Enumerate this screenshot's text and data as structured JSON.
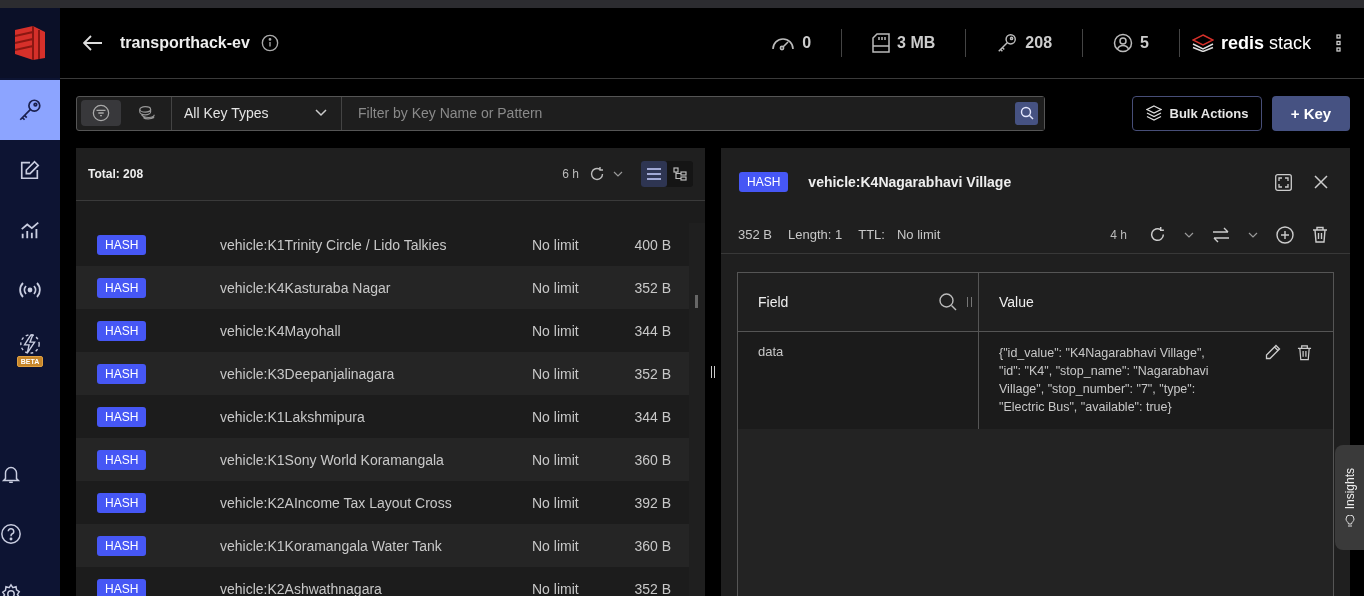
{
  "sidebar": {
    "nav": [
      {
        "kind": "browser",
        "selected": true
      },
      {
        "kind": "workbench",
        "selected": false
      },
      {
        "kind": "analysis",
        "selected": false
      },
      {
        "kind": "pubsub",
        "selected": false
      },
      {
        "kind": "triggers",
        "selected": false,
        "badge": "BETA"
      }
    ],
    "bottom": [
      {
        "kind": "notifications"
      },
      {
        "kind": "help"
      },
      {
        "kind": "settings"
      }
    ]
  },
  "header": {
    "db_name": "transporthack-ev",
    "stats": [
      {
        "kind": "ops",
        "value": "0"
      },
      {
        "kind": "memory",
        "value": "3 MB"
      },
      {
        "kind": "keys",
        "value": "208"
      },
      {
        "kind": "clients",
        "value": "5"
      }
    ],
    "brand": "**redis** stack"
  },
  "filter": {
    "modes": [
      {
        "kind": "filter",
        "selected": true
      },
      {
        "kind": "search",
        "selected": false
      }
    ],
    "key_type": "All Key Types",
    "placeholder": "Filter by Key Name or Pattern"
  },
  "actions": [
    "Bulk Actions",
    "+ Key"
  ],
  "key_list": {
    "total": "Total: 208",
    "refresh": "6 h",
    "views": [
      {
        "kind": "list",
        "selected": true
      },
      {
        "kind": "tree",
        "selected": false
      }
    ],
    "rows": [
      {
        "type": "HASH",
        "key": "vehicle:K1Trinity Circle / Lido Talkies",
        "ttl": "No limit",
        "size": "400 B"
      },
      {
        "type": "HASH",
        "key": "vehicle:K4Kasturaba Nagar",
        "ttl": "No limit",
        "size": "352 B"
      },
      {
        "type": "HASH",
        "key": "vehicle:K4Mayohall",
        "ttl": "No limit",
        "size": "344 B"
      },
      {
        "type": "HASH",
        "key": "vehicle:K3Deepanjalinagara",
        "ttl": "No limit",
        "size": "352 B"
      },
      {
        "type": "HASH",
        "key": "vehicle:K1Lakshmipura",
        "ttl": "No limit",
        "size": "344 B"
      },
      {
        "type": "HASH",
        "key": "vehicle:K1Sony World Koramangala",
        "ttl": "No limit",
        "size": "360 B"
      },
      {
        "type": "HASH",
        "key": "vehicle:K2AIncome Tax Layout Cross",
        "ttl": "No limit",
        "size": "392 B"
      },
      {
        "type": "HASH",
        "key": "vehicle:K1Koramangala Water Tank",
        "ttl": "No limit",
        "size": "360 B"
      },
      {
        "type": "HASH",
        "key": "vehicle:K2Ashwathnagara",
        "ttl": "No limit",
        "size": "352 B"
      }
    ]
  },
  "details": {
    "type": "HASH",
    "key": "vehicle:K4Nagarabhavi Village",
    "size": "352 B",
    "length": "Length: 1",
    "ttl_label": "TTL:",
    "ttl": "No limit",
    "refresh": "4 h",
    "columns": [
      "Field",
      "Value"
    ],
    "rows": [
      {
        "field": "data",
        "value": "{\"id_value\": \"K4Nagarabhavi Village\", \"id\": \"K4\", \"stop_name\": \"Nagarabhavi Village\", \"stop_number\": \"7\", \"type\": \"Electric Bus\", \"available\": true}"
      }
    ]
  },
  "insights": "Insights"
}
